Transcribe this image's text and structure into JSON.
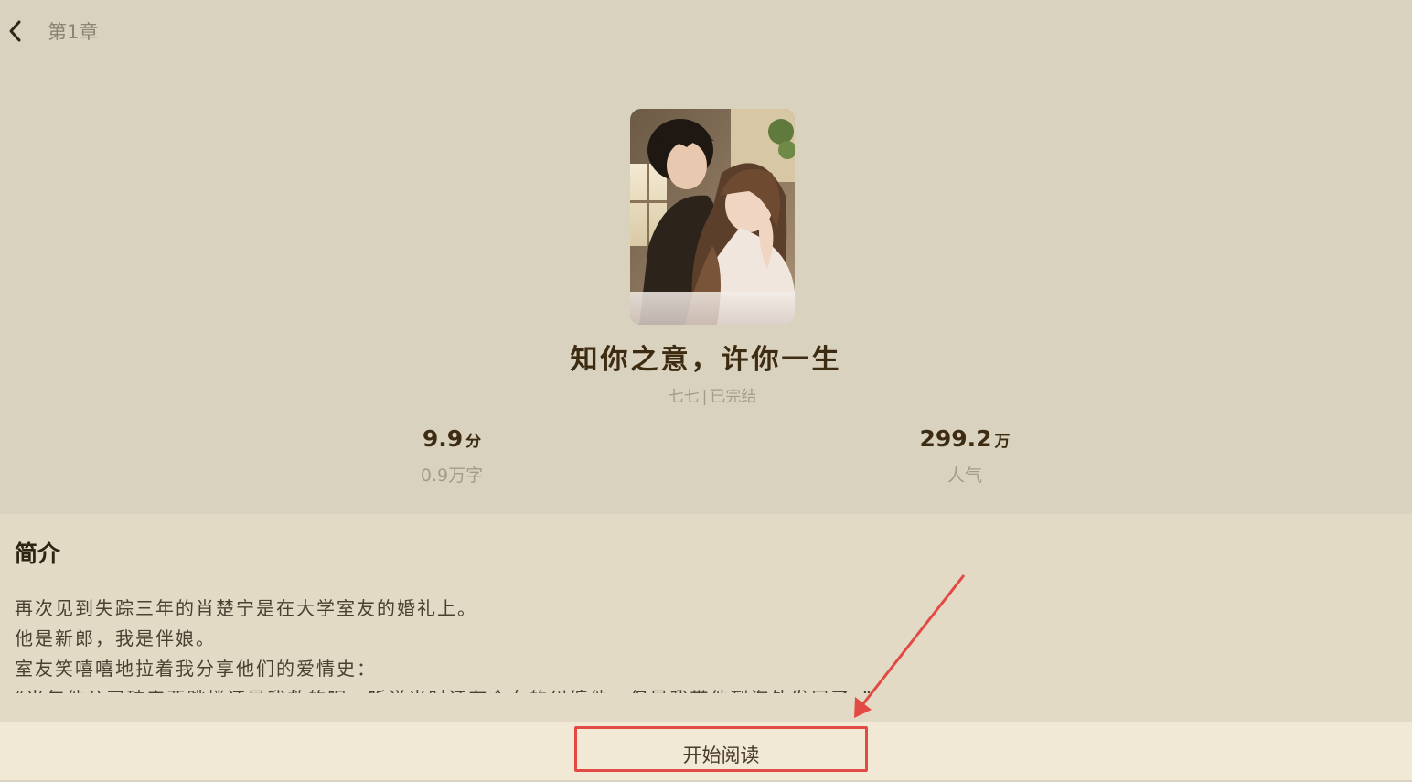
{
  "header": {
    "back_icon": "chevron-left-icon",
    "chapter": "第1章"
  },
  "book": {
    "cover_alt": "book-cover-illustration",
    "title": "知你之意，许你一生",
    "author": "七七",
    "separator": "|",
    "status": "已完结"
  },
  "stats": {
    "rating_value": "9.9",
    "rating_unit": "分",
    "word_count": "0.9万字",
    "popularity_value": "299.2",
    "popularity_unit": "万",
    "popularity_label": "人气"
  },
  "intro": {
    "heading": "简介",
    "lines": [
      "再次见到失踪三年的肖楚宁是在大学室友的婚礼上。",
      "他是新郎，我是伴娘。",
      "室友笑嘻嘻地拉着我分享他们的爱情史：",
      "“当年他公司破产要跳楼还是我救的呢，听说当时还有个女的纠缠他，但是我带他到海外发展了。”"
    ]
  },
  "action": {
    "start_reading": "开始阅读"
  },
  "colors": {
    "background": "#d9d2bf",
    "intro_panel": "#e2dac4",
    "bottom_bar": "#f1e9d6",
    "annotation_red": "#e24a45"
  }
}
